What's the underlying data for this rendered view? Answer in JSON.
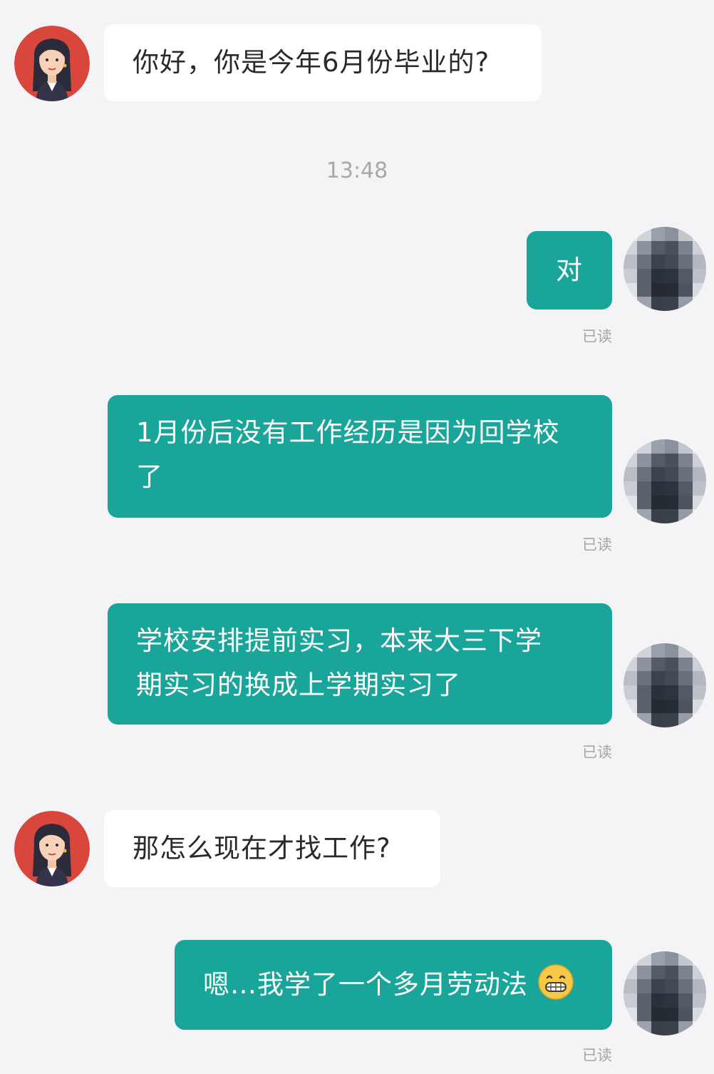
{
  "timestamp": "13:48",
  "messages": [
    {
      "side": "in",
      "text": "你好，你是今年6月份毕业的?"
    },
    {
      "side": "out",
      "text": "对",
      "status": "已读"
    },
    {
      "side": "out",
      "line1": "1月份后没有工作经历是因为回学校",
      "line2": "了",
      "status": "已读"
    },
    {
      "side": "out",
      "line1": "学校安排提前实习，本来大三下学",
      "line2": "期实习的换成上学期实习了",
      "status": "已读"
    },
    {
      "side": "in",
      "text": "那怎么现在才找工作?"
    },
    {
      "side": "out",
      "text": "嗯…我学了一个多月劳动法",
      "emoji": "grinning-face-emoji",
      "status": "已读"
    }
  ],
  "colors": {
    "background": "#f4f4f6",
    "incoming_bubble": "#ffffff",
    "outgoing_bubble": "#1aa59a",
    "read_status": "#a6a6a6"
  },
  "icons": {
    "contact_avatar": "woman-avatar-icon",
    "self_avatar": "pixelated-avatar-icon"
  }
}
